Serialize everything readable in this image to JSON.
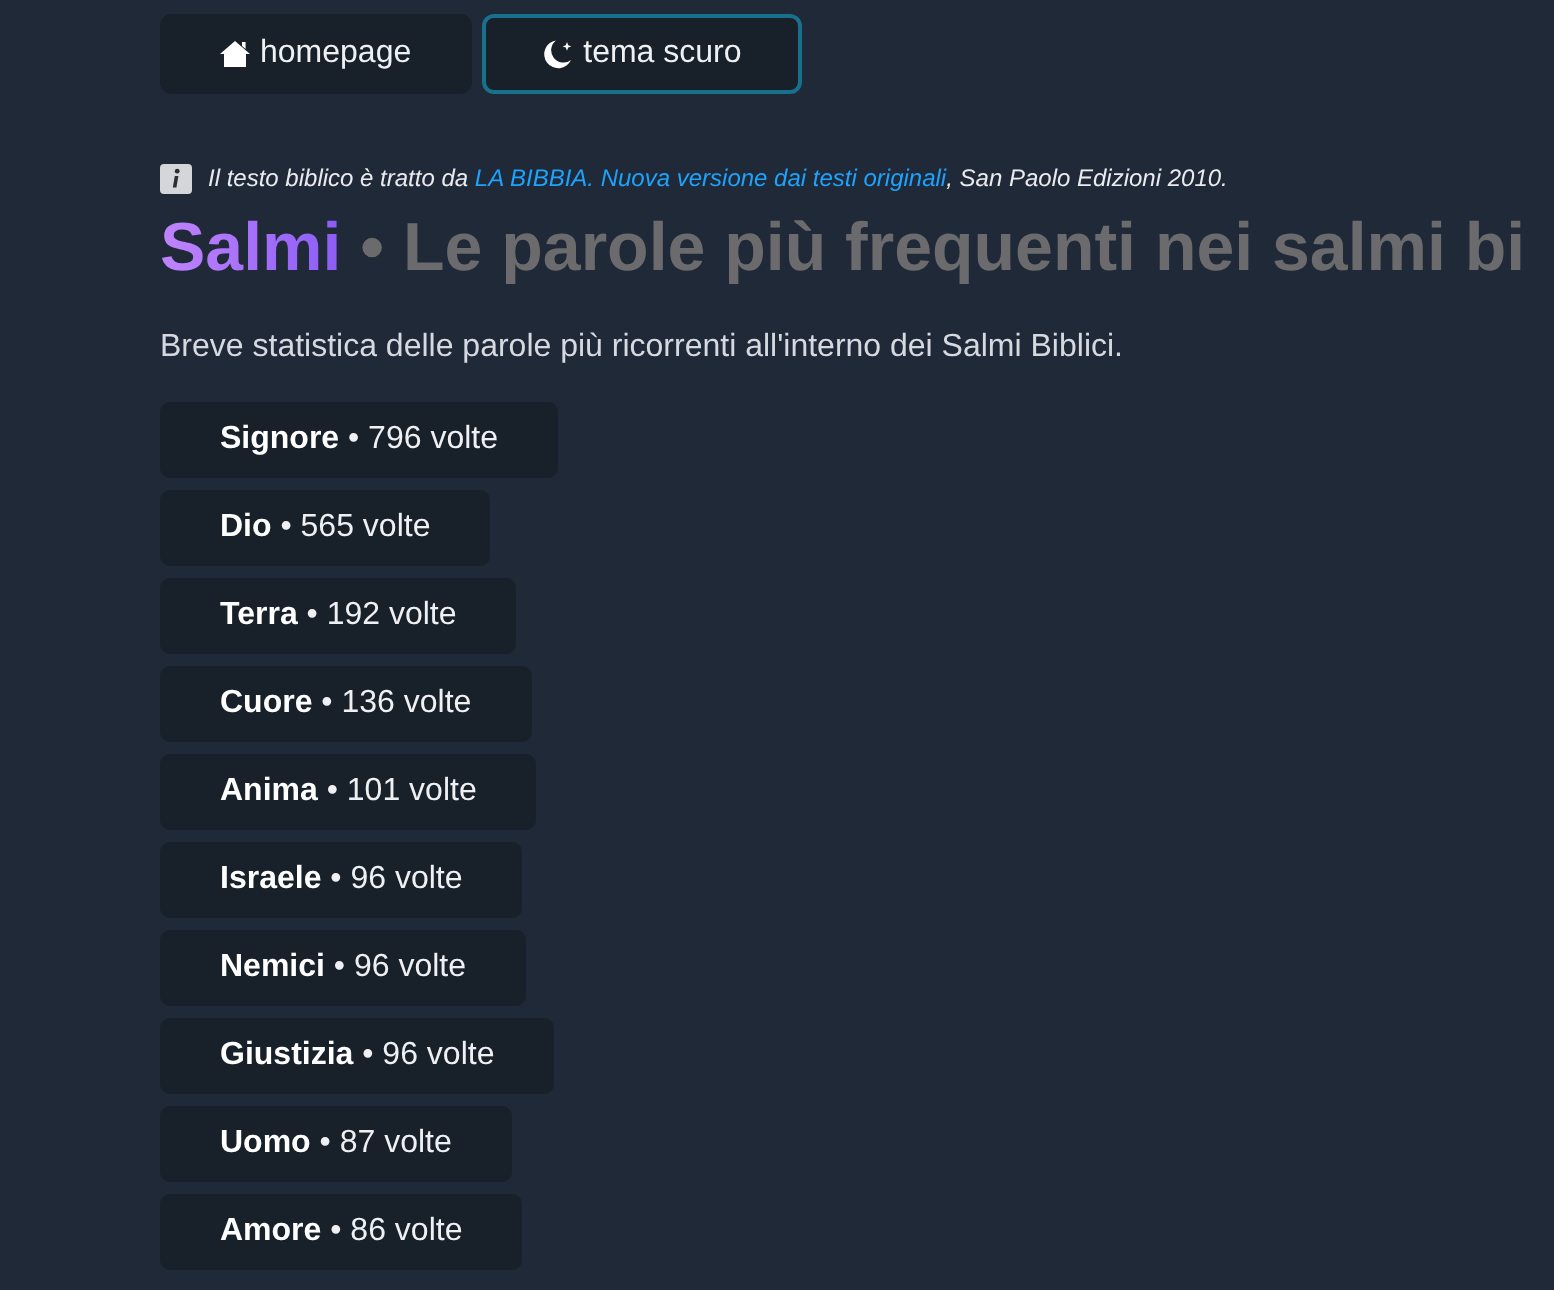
{
  "nav_buttons": [
    {
      "kind": "home",
      "label": "homepage",
      "active": false
    },
    {
      "kind": "theme",
      "label": "tema scuro",
      "active": true
    }
  ],
  "source_note": {
    "before": "Il testo biblico è tratto da",
    "link": "LA BIBBIA. Nuova versione dai testi originali",
    "after": ", San Paolo Edizioni 2010."
  },
  "title": {
    "highlight": "Salmi",
    "rest": "• Le parole più frequenti nei salmi bi"
  },
  "intro": "Breve statistica delle parole più ricorrenti all'interno dei Salmi Biblici.",
  "words": [
    {
      "text": "**Signore** • 796 volte"
    },
    {
      "text": "**Dio** • 565 volte"
    },
    {
      "text": "**Terra** • 192 volte"
    },
    {
      "text": "**Cuore** • 136 volte"
    },
    {
      "text": "**Anima** • 101 volte"
    },
    {
      "text": "**Israele** • 96 volte"
    },
    {
      "text": "**Nemici** • 96 volte"
    },
    {
      "text": "**Giustizia** • 96 volte"
    },
    {
      "text": "**Uomo** • 87 volte"
    },
    {
      "text": "**Amore** • 86 volte"
    }
  ]
}
